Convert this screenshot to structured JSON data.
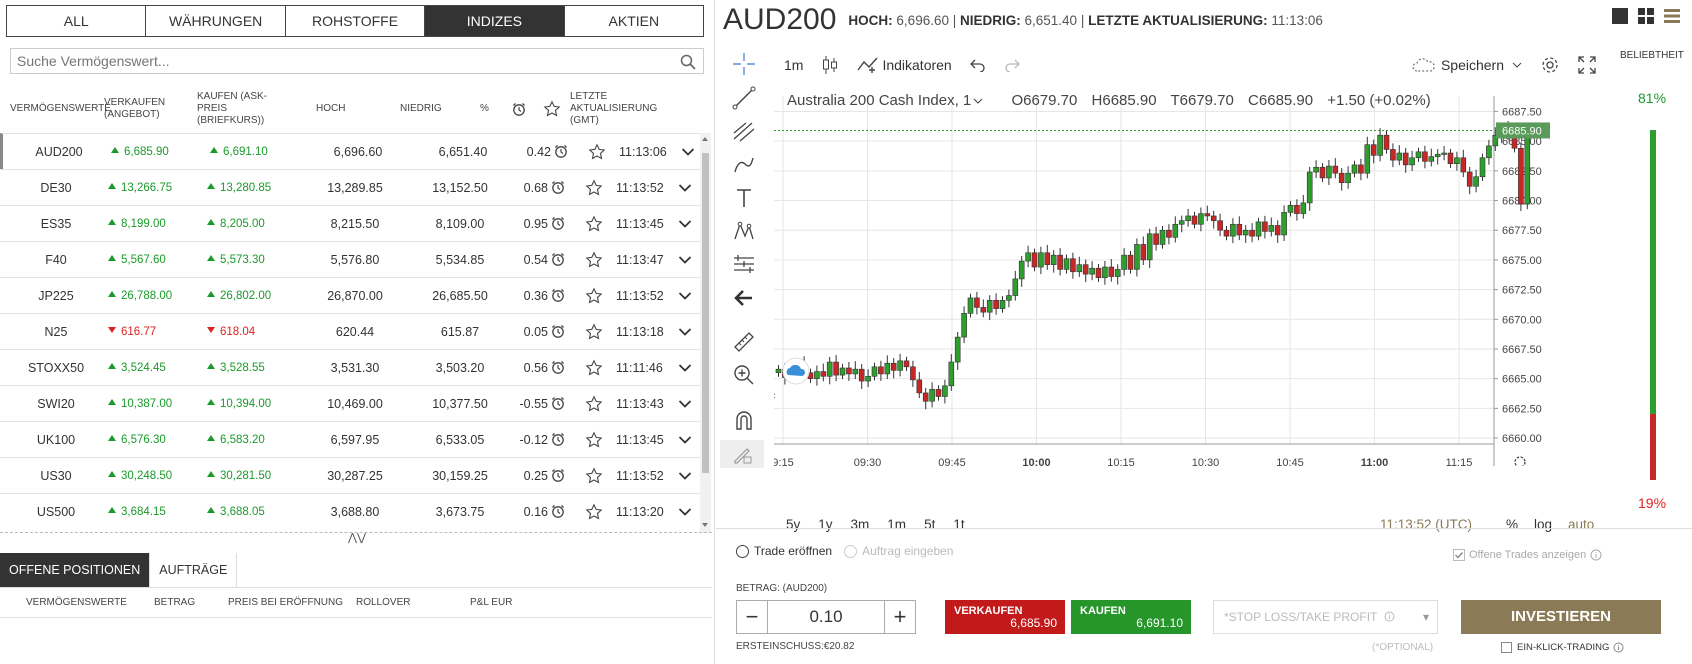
{
  "category_tabs": [
    "ALL",
    "WÄHRUNGEN",
    "ROHSTOFFE",
    "INDIZES",
    "AKTIEN"
  ],
  "search": {
    "placeholder": "Suche Vermögenswert..."
  },
  "table_headers": {
    "asset": "VERMÖGENSWERTE",
    "sell": "VERKAUFEN (ANGEBOT)",
    "buy": "KAUFEN (ASK-PREIS (BRIEFKURS))",
    "high": "HOCH",
    "low": "NIEDRIG",
    "pct": "%",
    "last_update": "LETZTE AKTUALISIERUNG (GMT)"
  },
  "instruments": [
    {
      "name": "AUD200",
      "bid": "6,685.90",
      "ask": "6,691.10",
      "high": "6,696.60",
      "low": "6,651.40",
      "pct": "0.42",
      "time": "11:13:06",
      "dir": "up"
    },
    {
      "name": "DE30",
      "bid": "13,266.75",
      "ask": "13,280.85",
      "high": "13,289.85",
      "low": "13,152.50",
      "pct": "0.68",
      "time": "11:13:52",
      "dir": "up"
    },
    {
      "name": "ES35",
      "bid": "8,199.00",
      "ask": "8,205.00",
      "high": "8,215.50",
      "low": "8,109.00",
      "pct": "0.95",
      "time": "11:13:45",
      "dir": "up"
    },
    {
      "name": "F40",
      "bid": "5,567.60",
      "ask": "5,573.30",
      "high": "5,576.80",
      "low": "5,534.85",
      "pct": "0.54",
      "time": "11:13:47",
      "dir": "up"
    },
    {
      "name": "JP225",
      "bid": "26,788.00",
      "ask": "26,802.00",
      "high": "26,870.00",
      "low": "26,685.50",
      "pct": "0.36",
      "time": "11:13:52",
      "dir": "up"
    },
    {
      "name": "N25",
      "bid": "616.77",
      "ask": "618.04",
      "high": "620.44",
      "low": "615.87",
      "pct": "0.05",
      "time": "11:13:18",
      "dir": "down"
    },
    {
      "name": "STOXX50",
      "bid": "3,524.45",
      "ask": "3,528.55",
      "high": "3,531.30",
      "low": "3,503.20",
      "pct": "0.56",
      "time": "11:11:46",
      "dir": "up"
    },
    {
      "name": "SWI20",
      "bid": "10,387.00",
      "ask": "10,394.00",
      "high": "10,469.00",
      "low": "10,377.50",
      "pct": "-0.55",
      "time": "11:13:43",
      "dir": "up"
    },
    {
      "name": "UK100",
      "bid": "6,576.30",
      "ask": "6,583.20",
      "high": "6,597.95",
      "low": "6,533.05",
      "pct": "-0.12",
      "time": "11:13:45",
      "dir": "up"
    },
    {
      "name": "US30",
      "bid": "30,248.50",
      "ask": "30,281.50",
      "high": "30,287.25",
      "low": "30,159.25",
      "pct": "0.25",
      "time": "11:13:52",
      "dir": "up"
    },
    {
      "name": "US500",
      "bid": "3,684.15",
      "ask": "3,688.05",
      "high": "3,688.80",
      "low": "3,673.75",
      "pct": "0.16",
      "time": "11:13:20",
      "dir": "up"
    }
  ],
  "positions": {
    "tabs": [
      "OFFENE POSITIONEN",
      "AUFTRÄGE"
    ],
    "headers": [
      "VERMÖGENSWERTE",
      "BETRAG",
      "PREIS BEI ERÖFFNUNG",
      "ROLLOVER",
      "P&L EUR"
    ]
  },
  "header": {
    "symbol": "AUD200",
    "high_label": "HOCH:",
    "high": "6,696.60",
    "low_label": "NIEDRIG:",
    "low": "6,651.40",
    "update_label": "LETZTE AKTUALISIERUNG:",
    "update": "11:13:06"
  },
  "chart_toolbar": {
    "interval": "1m",
    "indicators": "Indikatoren",
    "save": "Speichern"
  },
  "legend": {
    "name": "Australia 200 Cash Index, 1",
    "o": "O6679.70",
    "h": "H6685.90",
    "t": "T6679.70",
    "c": "C6685.90",
    "chg": "+1.50 (+0.02%)"
  },
  "chart_data": {
    "type": "candlestick",
    "last_price": "6685.90",
    "y_ticks": [
      "6687.50",
      "6685.00",
      "6682.50",
      "6680.00",
      "6677.50",
      "6675.00",
      "6672.50",
      "6670.00",
      "6667.50",
      "6665.00",
      "6662.50",
      "6660.00"
    ],
    "x_ticks": [
      "9:15",
      "09:30",
      "09:45",
      "10:00",
      "10:15",
      "10:30",
      "10:45",
      "11:00",
      "11:15"
    ],
    "ylim": [
      6659.5,
      6688.8
    ],
    "closes": [
      6665.8,
      6665.1,
      6665.9,
      6666.3,
      6665.5,
      6665.0,
      6665.6,
      6665.2,
      6666.4,
      6665.3,
      6665.9,
      6665.4,
      6665.8,
      6664.8,
      6665.2,
      6666.0,
      6665.4,
      6666.3,
      6665.7,
      6666.5,
      6666.0,
      6664.9,
      6663.8,
      6663.1,
      6664.1,
      6663.5,
      6664.4,
      6666.4,
      6668.5,
      6670.5,
      6671.8,
      6671.0,
      6670.6,
      6671.6,
      6670.9,
      6671.6,
      6672.0,
      6673.4,
      6674.9,
      6675.6,
      6674.4,
      6675.6,
      6674.6,
      6675.4,
      6674.2,
      6675.1,
      6674.0,
      6674.6,
      6673.8,
      6674.3,
      6673.5,
      6674.4,
      6673.6,
      6674.2,
      6675.4,
      6674.2,
      6676.3,
      6675.0,
      6677.2,
      6676.3,
      6677.5,
      6676.9,
      6678.0,
      6678.3,
      6678.7,
      6678.0,
      6678.9,
      6678.7,
      6678.3,
      6677.5,
      6677.0,
      6678.0,
      6677.1,
      6677.5,
      6677.0,
      6678.2,
      6677.4,
      6677.9,
      6677.1,
      6679.0,
      6679.6,
      6678.9,
      6679.8,
      6682.4,
      6682.8,
      6681.9,
      6682.9,
      6682.3,
      6681.5,
      6682.3,
      6683.0,
      6682.3,
      6684.7,
      6683.8,
      6685.5,
      6684.3,
      6683.4,
      6684.0,
      6683.0,
      6683.6,
      6684.1,
      6683.3,
      6683.7,
      6683.9,
      6684.0,
      6683.1,
      6683.6,
      6682.4,
      6681.2,
      6682.0,
      6683.6,
      6684.6,
      6685.5,
      6686.1,
      6685.6,
      6684.4,
      6679.7,
      6685.9
    ],
    "series_colors": {
      "up": "#2e9e2e",
      "down": "#c62828"
    }
  },
  "range_buttons": [
    "5y",
    "1y",
    "3m",
    "1m",
    "5t",
    "1t"
  ],
  "clock": "11:13:52 (UTC)",
  "scale_options": {
    "pct": "%",
    "log": "log",
    "auto": "auto"
  },
  "offene_trades": "Offene Trades anzeigen",
  "popularity": {
    "label": "BELIEBTHEIT",
    "buy": "81%",
    "sell": "19%",
    "buy_frac": 0.81,
    "buy_color": "#2e9e2e",
    "sell_color": "#c62828"
  },
  "order": {
    "trade_open": "Trade eröffnen",
    "order_enter": "Auftrag eingeben",
    "amount_label": "BETRAG: (AUD200)",
    "amount": "0.10",
    "margin": "ERSTEINSCHUSS:€20.82",
    "sell_label": "VERKAUFEN",
    "sell_price": "6,685.90",
    "buy_label": "KAUFEN",
    "buy_price": "6,691.10",
    "sltp": "*STOP LOSS/TAKE PROFIT",
    "optional": "(*OPTIONAL)",
    "invest": "INVESTIEREN",
    "one_click": "EIN-KLICK-TRADING"
  }
}
